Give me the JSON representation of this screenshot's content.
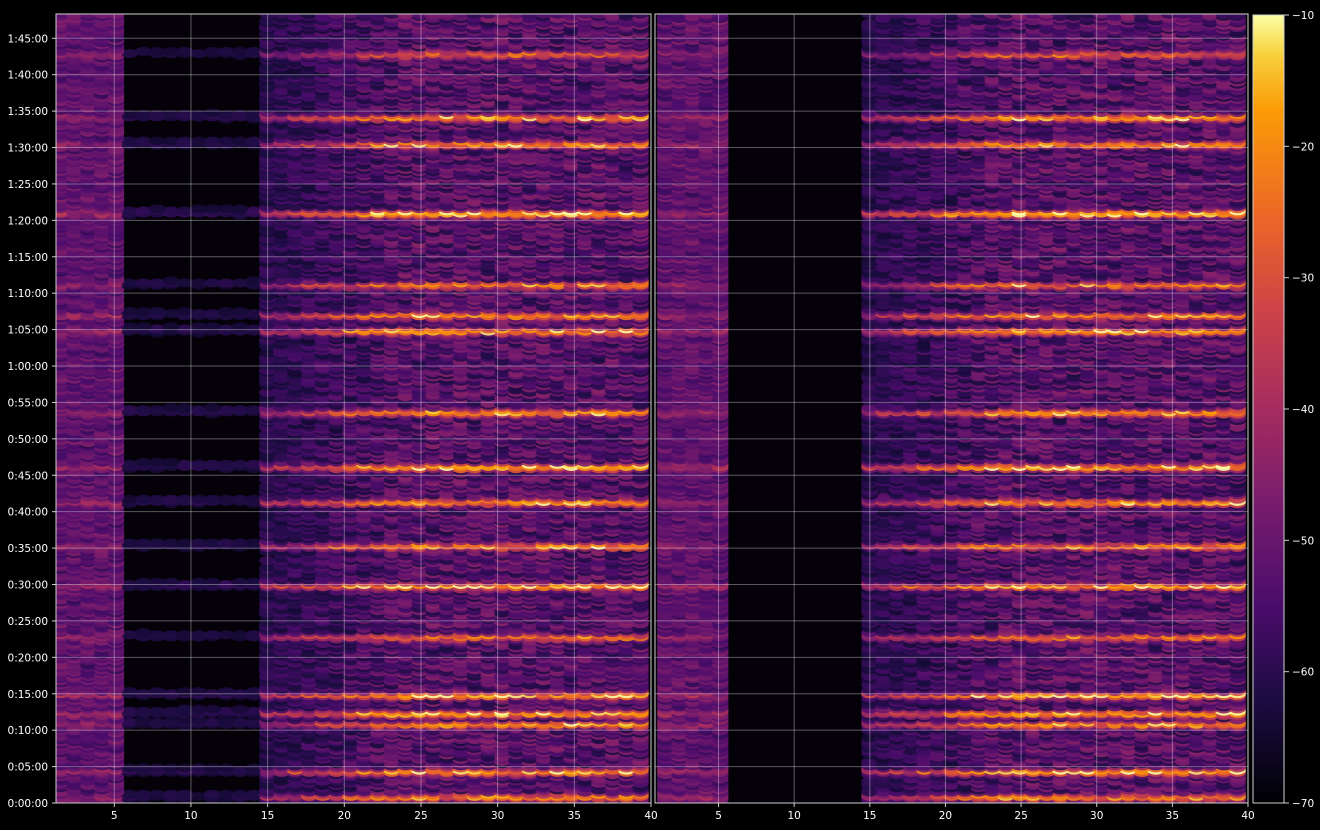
{
  "chart_data": {
    "type": "heatmap",
    "title": "",
    "xlabel": "",
    "ylabel": "",
    "grid": true,
    "panels": [
      {
        "xlim": [
          1.2,
          40
        ],
        "xticks": [
          5,
          10,
          15,
          20,
          25,
          30,
          35,
          40
        ]
      },
      {
        "xlim": [
          0.8,
          40
        ],
        "xticks": [
          5,
          10,
          15,
          20,
          25,
          30,
          35,
          40
        ]
      }
    ],
    "y_ticks_seconds": [
      0,
      300,
      600,
      900,
      1200,
      1500,
      1800,
      2100,
      2400,
      2700,
      3000,
      3300,
      3600,
      3900,
      4200,
      4500,
      4800,
      5100,
      5400,
      5700,
      6000,
      6300
    ],
    "y_tick_labels": [
      "0:00:00",
      "0:05:00",
      "0:10:00",
      "0:15:00",
      "0:20:00",
      "0:25:00",
      "0:30:00",
      "0:35:00",
      "0:40:00",
      "0:45:00",
      "0:50:00",
      "0:55:00",
      "1:00:00",
      "1:05:00",
      "1:10:00",
      "1:15:00",
      "1:20:00",
      "1:25:00",
      "1:30:00",
      "1:35:00",
      "1:40:00",
      "1:45:00"
    ],
    "ylim_seconds": [
      0,
      6500
    ],
    "colorbar": {
      "colormap": "inferno",
      "range": [
        -70,
        -10
      ],
      "ticks": [
        -70,
        -60,
        -50,
        -40,
        -30,
        -20,
        -10
      ],
      "tick_labels": [
        "−70",
        "−60",
        "−50",
        "−40",
        "−30",
        "−20",
        "−10"
      ]
    },
    "bright_bands_seconds": [
      {
        "t": 60,
        "level": -30
      },
      {
        "t": 270,
        "level": -28
      },
      {
        "t": 660,
        "level": -30
      },
      {
        "t": 750,
        "level": -24
      },
      {
        "t": 900,
        "level": -28
      },
      {
        "t": 1380,
        "level": -34
      },
      {
        "t": 1800,
        "level": -26
      },
      {
        "t": 2130,
        "level": -30
      },
      {
        "t": 2490,
        "level": -26
      },
      {
        "t": 2780,
        "level": -20
      },
      {
        "t": 3230,
        "level": -28
      },
      {
        "t": 3900,
        "level": -26
      },
      {
        "t": 4030,
        "level": -30
      },
      {
        "t": 4280,
        "level": -34
      },
      {
        "t": 4870,
        "level": -18
      },
      {
        "t": 5440,
        "level": -30
      },
      {
        "t": 5660,
        "level": -26
      },
      {
        "t": 6180,
        "level": -40
      }
    ]
  }
}
